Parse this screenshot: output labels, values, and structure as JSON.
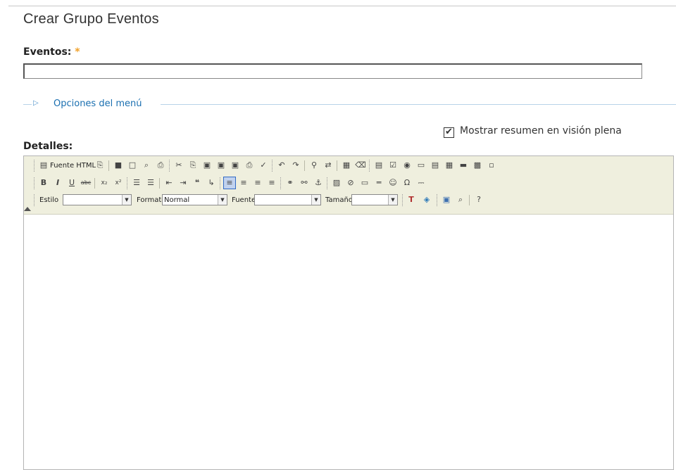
{
  "page": {
    "title": "Crear Grupo Eventos"
  },
  "eventos": {
    "label": "Eventos:",
    "required_mark": "*",
    "value": ""
  },
  "menu_options": {
    "label": "Opciones del menú"
  },
  "summary": {
    "label": "Mostrar resumen en visión plena",
    "checked": true
  },
  "details": {
    "label": "Detalles:"
  },
  "editor": {
    "toolbar": {
      "source_html_label": "Fuente HTML",
      "style_label": "Estilo",
      "style_value": "",
      "format_label": "Formato",
      "format_value": "Normal",
      "font_label": "Fuente",
      "font_value": "",
      "size_label": "Tamaño",
      "size_value": "",
      "row1_icons": [
        "doc-icon",
        "save-icon",
        "new-page-icon",
        "preview-icon",
        "template-icon",
        "cut-icon",
        "copy-icon",
        "paste-icon",
        "paste-text-icon",
        "paste-word-icon",
        "print-icon",
        "spellcheck-icon",
        "undo-icon",
        "redo-icon",
        "find-icon",
        "replace-icon",
        "select-all-icon",
        "remove-format-icon",
        "form-icon",
        "checkbox-icon",
        "radio-icon",
        "textfield-icon",
        "textarea-icon",
        "select-field-icon",
        "button-icon",
        "image-button-icon",
        "hidden-field-icon"
      ],
      "row2_icons": [
        "bold-icon",
        "italic-icon",
        "underline-icon",
        "strike-icon",
        "subscript-icon",
        "superscript-icon",
        "ordered-list-icon",
        "unordered-list-icon",
        "outdent-icon",
        "indent-icon",
        "blockquote-icon",
        "create-div-icon",
        "align-left-icon",
        "align-center-icon",
        "align-right-icon",
        "align-justify-icon",
        "link-icon",
        "unlink-icon",
        "anchor-icon",
        "image-icon",
        "flash-icon",
        "table-icon",
        "horizontal-rule-icon",
        "smiley-icon",
        "special-char-icon",
        "page-break-icon"
      ],
      "row3_icons": [
        "text-color-icon",
        "bg-color-icon",
        "maximize-icon",
        "show-blocks-icon",
        "about-icon"
      ]
    },
    "content": ""
  }
}
